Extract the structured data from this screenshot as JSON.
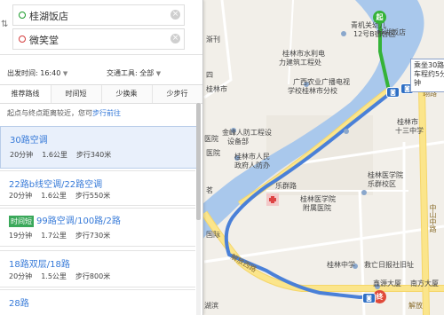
{
  "map": {
    "labels": {
      "l1": "青机关幼儿",
      "l2": "12号B宿舍区",
      "l3": "桂林市水利电",
      "l4": "力建筑工程处",
      "l5": "广西农业广播电视",
      "l6": "学校桂林市分校",
      "l7": "桂林市",
      "l8": "十三中学",
      "l9": "金峰人防工程设",
      "l10": "设备部",
      "l11": "桂林市人民",
      "l12": "政府人防办",
      "l13": "乐群路",
      "l14": "桂林医学院",
      "l15": "附属医院",
      "l16": "桂林医学院",
      "l17": "乐群校区",
      "l18": "桂林中学",
      "l19": "救亡日报社旧址",
      "l20": "鑫源大厦",
      "l21": "南方大厦",
      "l22": "解放西路",
      "l23": "桂湖饭店",
      "l24": "翊路",
      "l25": "医院",
      "l26": "四",
      "l27": "桂林市",
      "l28": "中山中路",
      "l29": "湖滨",
      "l30": "解放",
      "l31": "渐刊",
      "l32": "茗",
      "l33": "医院",
      "l34": "国际"
    },
    "callout": "乘坐30路车程约5分钟",
    "start_marker": "起",
    "end_marker": "终"
  },
  "panel": {
    "start": "桂湖饭店",
    "end": "微笑堂",
    "depart_label": "出发时间: 16:40",
    "traffic_label": "交通工具: 全部",
    "tabs": [
      "推荐路线",
      "时间短",
      "少换乘",
      "少步行"
    ],
    "walk_hint_prefix": "起点与终点距离较近，您可",
    "walk_hint_link": "步行前往",
    "routes": [
      {
        "title": "30路空调",
        "time": "20分钟",
        "distance": "1.6公里",
        "walk": "步行340米",
        "badge": ""
      },
      {
        "title": "22路b线空调/22路空调",
        "time": "20分钟",
        "distance": "1.6公里",
        "walk": "步行550米",
        "badge": ""
      },
      {
        "title": "99路空调/100路/2路",
        "time": "19分钟",
        "distance": "1.7公里",
        "walk": "步行730米",
        "badge": "时间短"
      },
      {
        "title": "18路双层/18路",
        "time": "20分钟",
        "distance": "1.5公里",
        "walk": "步行800米",
        "badge": ""
      },
      {
        "title": "28路",
        "time": "",
        "distance": "",
        "walk": "",
        "badge": ""
      }
    ]
  },
  "colors": {
    "route_blue": "#4a80d8",
    "walk_green": "#35b338",
    "river": "#a9c8ec",
    "arterial": "#fbe58b"
  }
}
